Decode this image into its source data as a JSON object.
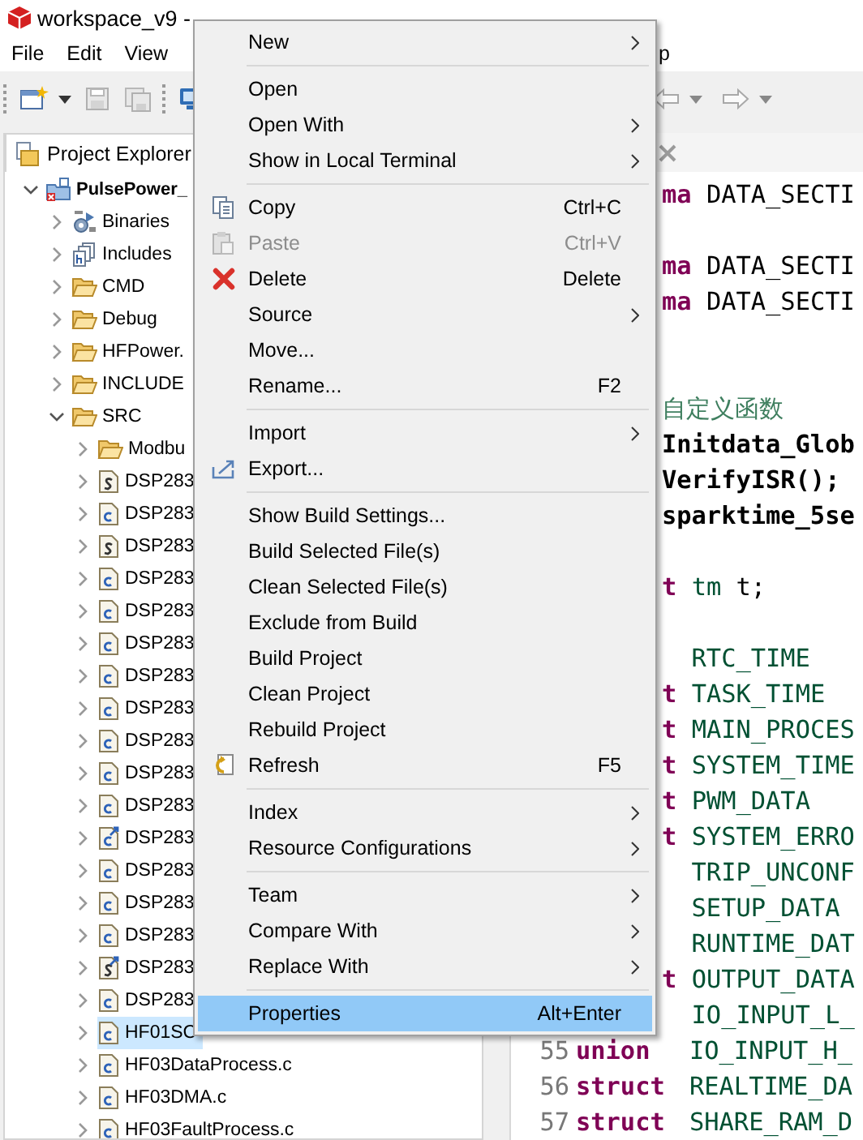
{
  "window": {
    "title": "workspace_v9 -"
  },
  "menubar": {
    "left": [
      "File",
      "Edit",
      "View"
    ],
    "right": [
      "p"
    ]
  },
  "project_explorer": {
    "title": "Project Explorer",
    "tree": [
      {
        "label": "PulsePower_",
        "kind": "project",
        "expanded": true,
        "selected": false,
        "children": [
          {
            "label": "Binaries",
            "kind": "binaries",
            "expanded": false,
            "selected": false
          },
          {
            "label": "Includes",
            "kind": "includes",
            "expanded": false,
            "selected": false
          },
          {
            "label": "CMD",
            "kind": "folder",
            "expanded": false,
            "selected": false
          },
          {
            "label": "Debug",
            "kind": "folder",
            "expanded": false,
            "selected": false
          },
          {
            "label": "HFPower.",
            "kind": "folder",
            "expanded": false,
            "selected": false
          },
          {
            "label": "INCLUDE",
            "kind": "folder",
            "expanded": false,
            "selected": false
          },
          {
            "label": "SRC",
            "kind": "folder",
            "expanded": true,
            "selected": false,
            "children": [
              {
                "label": "Modbu",
                "kind": "folder",
                "expanded": false,
                "selected": false
              },
              {
                "label": "DSP283",
                "kind": "s_file",
                "expanded": false,
                "selected": false
              },
              {
                "label": "DSP283",
                "kind": "c_file",
                "expanded": false,
                "selected": false
              },
              {
                "label": "DSP283",
                "kind": "s_file",
                "expanded": false,
                "selected": false
              },
              {
                "label": "DSP283",
                "kind": "c_file",
                "expanded": false,
                "selected": false
              },
              {
                "label": "DSP283",
                "kind": "c_file",
                "expanded": false,
                "selected": false
              },
              {
                "label": "DSP283",
                "kind": "c_file",
                "expanded": false,
                "selected": false
              },
              {
                "label": "DSP283",
                "kind": "c_file",
                "expanded": false,
                "selected": false
              },
              {
                "label": "DSP283",
                "kind": "c_file",
                "expanded": false,
                "selected": false
              },
              {
                "label": "DSP283",
                "kind": "c_file",
                "expanded": false,
                "selected": false
              },
              {
                "label": "DSP283",
                "kind": "c_file",
                "expanded": false,
                "selected": false
              },
              {
                "label": "DSP283",
                "kind": "c_file",
                "expanded": false,
                "selected": false
              },
              {
                "label": "DSP283",
                "kind": "c_link",
                "expanded": false,
                "selected": false
              },
              {
                "label": "DSP283",
                "kind": "c_file",
                "expanded": false,
                "selected": false
              },
              {
                "label": "DSP283",
                "kind": "c_file",
                "expanded": false,
                "selected": false
              },
              {
                "label": "DSP283",
                "kind": "c_file",
                "expanded": false,
                "selected": false
              },
              {
                "label": "DSP283",
                "kind": "s_link",
                "expanded": false,
                "selected": false
              },
              {
                "label": "DSP283",
                "kind": "c_file",
                "expanded": false,
                "selected": false
              },
              {
                "label": "HF01SC",
                "kind": "c_file",
                "expanded": false,
                "selected": true
              },
              {
                "label": "HF03DataProcess.c",
                "kind": "c_file",
                "expanded": false,
                "selected": false
              },
              {
                "label": "HF03DMA.c",
                "kind": "c_file",
                "expanded": false,
                "selected": false
              },
              {
                "label": "HF03FaultProcess.c",
                "kind": "c_file",
                "expanded": false,
                "selected": false
              }
            ]
          }
        ]
      }
    ]
  },
  "editor": {
    "lines": [
      {
        "kind": "cut",
        "parts": [
          {
            "kind": "keyword",
            "text": "ma"
          },
          {
            "kind": "plain",
            "text": "DATA_SECTI"
          }
        ]
      },
      {
        "kind": "blank"
      },
      {
        "kind": "cut",
        "parts": [
          {
            "kind": "keyword",
            "text": "ma"
          },
          {
            "kind": "plain",
            "text": "DATA_SECTI"
          }
        ]
      },
      {
        "kind": "cut",
        "parts": [
          {
            "kind": "keyword",
            "text": "ma"
          },
          {
            "kind": "plain",
            "text": "DATA_SECTI"
          }
        ]
      },
      {
        "kind": "blank"
      },
      {
        "kind": "blank"
      },
      {
        "kind": "cut",
        "parts": [
          {
            "kind": "comment",
            "text": "自定义函数"
          }
        ]
      },
      {
        "kind": "cut",
        "parts": [
          {
            "kind": "bold",
            "text": "Initdata_Glob"
          }
        ]
      },
      {
        "kind": "cut",
        "parts": [
          {
            "kind": "bold",
            "text": "VerifyISR();"
          }
        ]
      },
      {
        "kind": "cut",
        "parts": [
          {
            "kind": "bold",
            "text": "sparktime_5se"
          }
        ]
      },
      {
        "kind": "blank"
      },
      {
        "kind": "cut",
        "parts": [
          {
            "kind": "keyword",
            "text": "t"
          },
          {
            "kind": "type",
            "text": "tm"
          },
          {
            "kind": "plain",
            "text": "t;"
          }
        ]
      },
      {
        "kind": "blank"
      },
      {
        "kind": "cut",
        "parts": [
          {
            "kind": "type",
            "text": "RTC_TIME"
          }
        ]
      },
      {
        "kind": "cut",
        "parts": [
          {
            "kind": "keyword",
            "text": "t"
          },
          {
            "kind": "type",
            "text": "TASK_TIME"
          }
        ]
      },
      {
        "kind": "cut",
        "parts": [
          {
            "kind": "keyword",
            "text": "t"
          },
          {
            "kind": "type",
            "text": "MAIN_PROCES"
          }
        ]
      },
      {
        "kind": "cut",
        "parts": [
          {
            "kind": "keyword",
            "text": "t"
          },
          {
            "kind": "type",
            "text": "SYSTEM_TIME"
          }
        ]
      },
      {
        "kind": "cut",
        "parts": [
          {
            "kind": "keyword",
            "text": "t"
          },
          {
            "kind": "type",
            "text": "PWM_DATA"
          }
        ]
      },
      {
        "kind": "cut",
        "parts": [
          {
            "kind": "keyword",
            "text": "t"
          },
          {
            "kind": "type",
            "text": "SYSTEM_ERRO"
          }
        ]
      },
      {
        "kind": "cut",
        "parts": [
          {
            "kind": "type",
            "text": "TRIP_UNCONF"
          }
        ]
      },
      {
        "kind": "cut",
        "parts": [
          {
            "kind": "type",
            "text": "SETUP_DATA"
          }
        ]
      },
      {
        "kind": "cut",
        "parts": [
          {
            "kind": "type",
            "text": "RUNTIME_DAT"
          }
        ]
      },
      {
        "kind": "cut",
        "parts": [
          {
            "kind": "keyword",
            "text": "t"
          },
          {
            "kind": "type",
            "text": "OUTPUT_DATA"
          }
        ]
      },
      {
        "kind": "cut",
        "parts": [
          {
            "kind": "type",
            "text": "IO_INPUT_L_"
          }
        ]
      },
      {
        "kind": "code",
        "number": "55",
        "parts": [
          {
            "kind": "keyword",
            "text": "union"
          },
          {
            "kind": "type",
            "text": "IO_INPUT_H_"
          }
        ]
      },
      {
        "kind": "code",
        "number": "56",
        "parts": [
          {
            "kind": "keyword",
            "text": "struct"
          },
          {
            "kind": "type",
            "text": "REALTIME_DA"
          }
        ]
      },
      {
        "kind": "code",
        "number": "57",
        "parts": [
          {
            "kind": "keyword",
            "text": "struct"
          },
          {
            "kind": "type",
            "text": "SHARE_RAM_D"
          }
        ]
      }
    ]
  },
  "context_menu": {
    "groups": [
      [
        {
          "label": "New",
          "kind": "plain",
          "submenu": true,
          "disabled": false,
          "selected": false
        }
      ],
      [
        {
          "label": "Open",
          "kind": "plain",
          "submenu": false,
          "disabled": false,
          "selected": false
        },
        {
          "label": "Open With",
          "kind": "plain",
          "submenu": true,
          "disabled": false,
          "selected": false
        },
        {
          "label": "Show in Local Terminal",
          "kind": "plain",
          "submenu": true,
          "disabled": false,
          "selected": false
        }
      ],
      [
        {
          "label": "Copy",
          "kind": "copy",
          "shortcut": "Ctrl+C",
          "submenu": false,
          "disabled": false,
          "selected": false
        },
        {
          "label": "Paste",
          "kind": "paste",
          "shortcut": "Ctrl+V",
          "submenu": false,
          "disabled": true,
          "selected": false
        },
        {
          "label": "Delete",
          "kind": "delete",
          "shortcut": "Delete",
          "submenu": false,
          "disabled": false,
          "selected": false
        },
        {
          "label": "Source",
          "kind": "plain",
          "submenu": true,
          "disabled": false,
          "selected": false
        },
        {
          "label": "Move...",
          "kind": "plain",
          "submenu": false,
          "disabled": false,
          "selected": false
        },
        {
          "label": "Rename...",
          "kind": "plain",
          "shortcut": "F2",
          "submenu": false,
          "disabled": false,
          "selected": false
        }
      ],
      [
        {
          "label": "Import",
          "kind": "plain",
          "submenu": true,
          "disabled": false,
          "selected": false
        },
        {
          "label": "Export...",
          "kind": "export",
          "submenu": false,
          "disabled": false,
          "selected": false
        }
      ],
      [
        {
          "label": "Show Build Settings...",
          "kind": "plain",
          "submenu": false,
          "disabled": false,
          "selected": false
        },
        {
          "label": "Build Selected File(s)",
          "kind": "plain",
          "submenu": false,
          "disabled": false,
          "selected": false
        },
        {
          "label": "Clean Selected File(s)",
          "kind": "plain",
          "submenu": false,
          "disabled": false,
          "selected": false
        },
        {
          "label": "Exclude from Build",
          "kind": "plain",
          "submenu": false,
          "disabled": false,
          "selected": false
        },
        {
          "label": "Build Project",
          "kind": "plain",
          "submenu": false,
          "disabled": false,
          "selected": false
        },
        {
          "label": "Clean Project",
          "kind": "plain",
          "submenu": false,
          "disabled": false,
          "selected": false
        },
        {
          "label": "Rebuild Project",
          "kind": "plain",
          "submenu": false,
          "disabled": false,
          "selected": false
        },
        {
          "label": "Refresh",
          "kind": "refresh",
          "shortcut": "F5",
          "submenu": false,
          "disabled": false,
          "selected": false
        }
      ],
      [
        {
          "label": "Index",
          "kind": "plain",
          "submenu": true,
          "disabled": false,
          "selected": false
        },
        {
          "label": "Resource Configurations",
          "kind": "plain",
          "submenu": true,
          "disabled": false,
          "selected": false
        }
      ],
      [
        {
          "label": "Team",
          "kind": "plain",
          "submenu": true,
          "disabled": false,
          "selected": false
        },
        {
          "label": "Compare With",
          "kind": "plain",
          "submenu": true,
          "disabled": false,
          "selected": false
        },
        {
          "label": "Replace With",
          "kind": "plain",
          "submenu": true,
          "disabled": false,
          "selected": false
        }
      ],
      [
        {
          "label": "Properties",
          "kind": "plain",
          "shortcut": "Alt+Enter",
          "submenu": false,
          "disabled": false,
          "selected": true
        }
      ]
    ]
  }
}
